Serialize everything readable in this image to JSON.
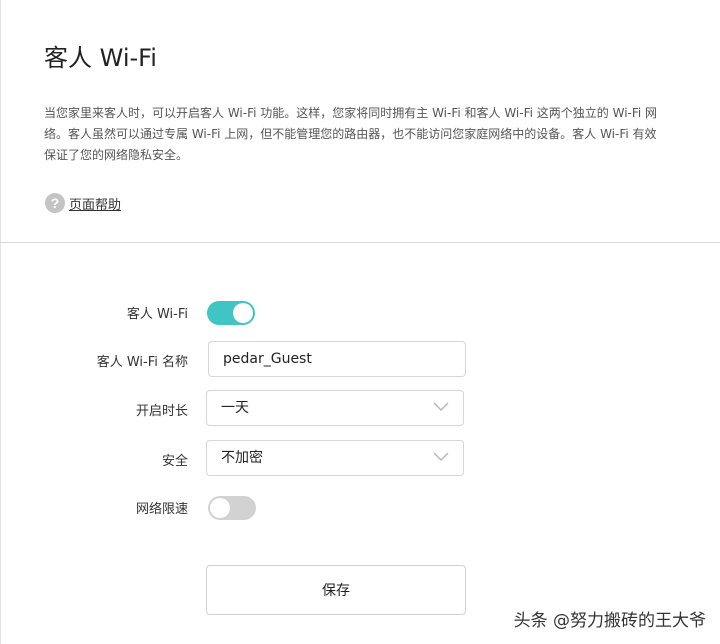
{
  "header": {
    "title": "客人 Wi-Fi",
    "description": "当您家里来客人时，可以开启客人 Wi-Fi 功能。这样，您家将同时拥有主 Wi-Fi 和客人 Wi-Fi 这两个独立的 Wi-Fi 网络。客人虽然可以通过专属 Wi-Fi 上网，但不能管理您的路由器，也不能访问您家庭网络中的设备。客人 Wi-Fi 有效保证了您的网络隐私安全。",
    "help_label": "页面帮助",
    "help_icon_glyph": "?"
  },
  "form": {
    "guest_wifi": {
      "label": "客人 Wi-Fi",
      "enabled": true
    },
    "wifi_name": {
      "label": "客人 Wi-Fi 名称",
      "value": "pedar_Guest"
    },
    "duration": {
      "label": "开启时长",
      "value": "一天"
    },
    "security": {
      "label": "安全",
      "value": "不加密"
    },
    "rate_limit": {
      "label": "网络限速",
      "enabled": false
    },
    "save_label": "保存"
  },
  "watermark": "头条 @努力搬砖的王大爷",
  "icons": {
    "help": "question-circle-icon",
    "dropdown": "chevron-down-icon"
  },
  "colors": {
    "toggle_on": "#40c4c4",
    "toggle_off": "#d2d2d2"
  }
}
